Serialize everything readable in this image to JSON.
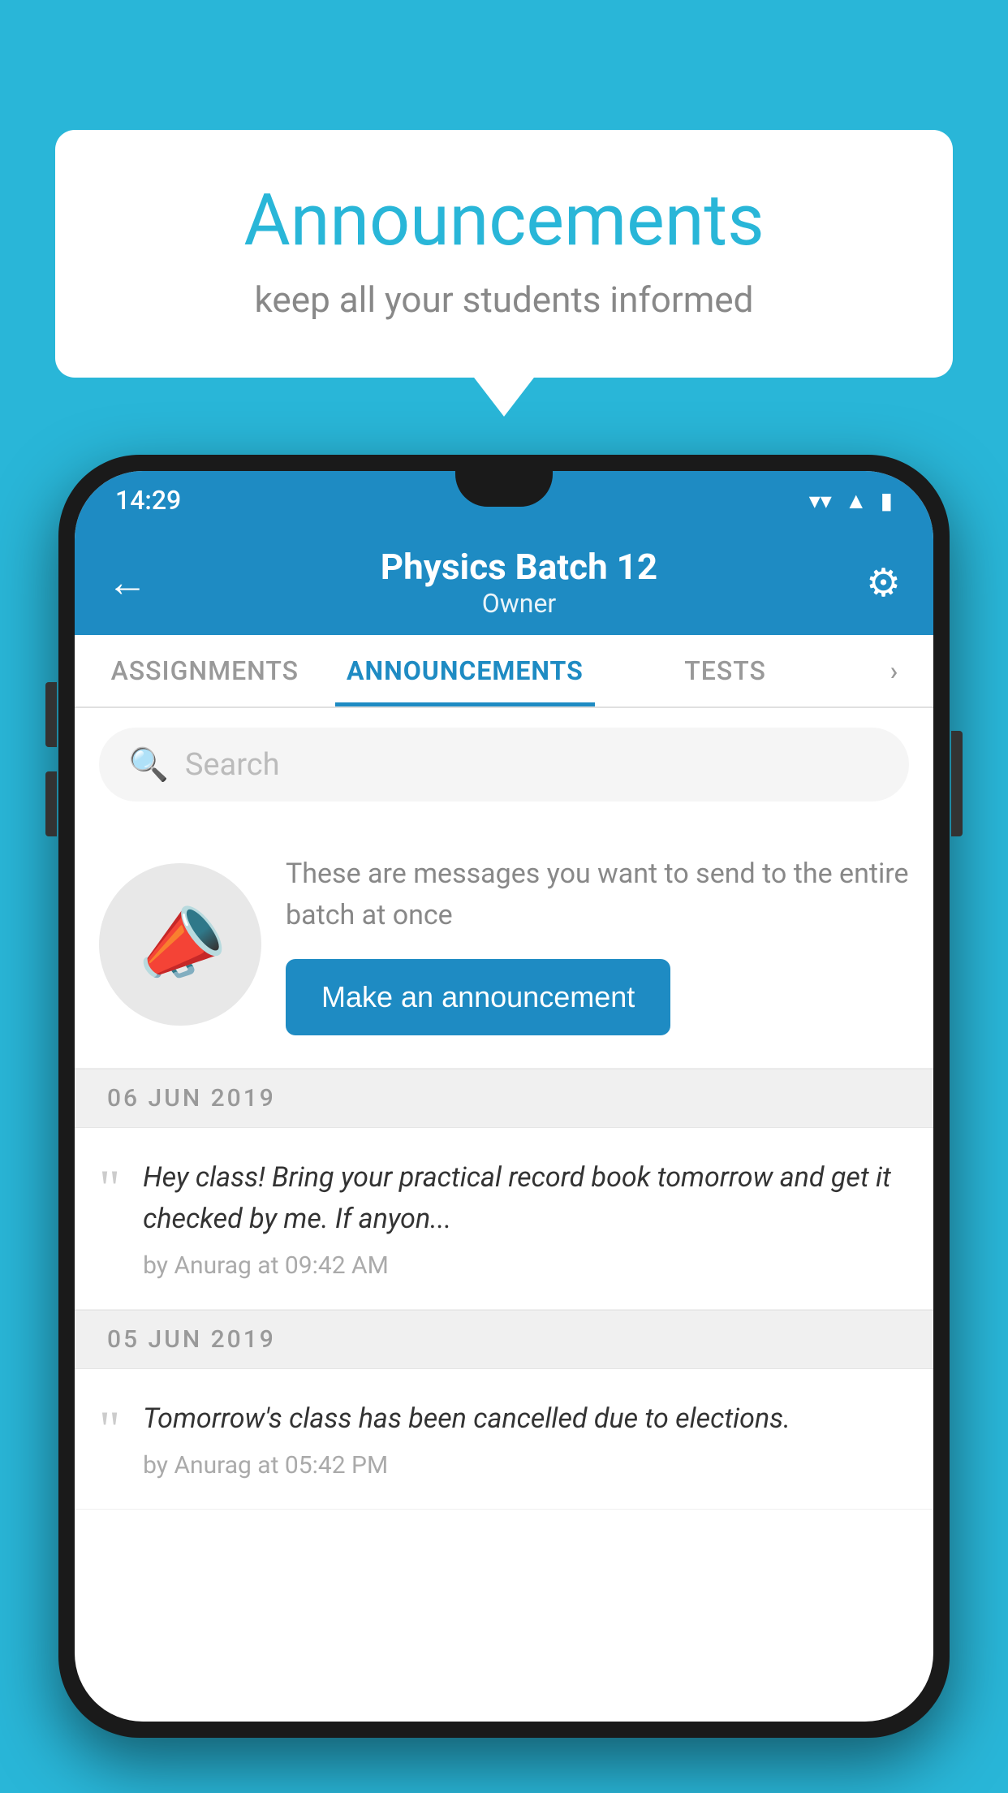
{
  "bubble": {
    "title": "Announcements",
    "subtitle": "keep all your students informed"
  },
  "status_bar": {
    "time": "14:29",
    "wifi": "▼",
    "signal": "▲",
    "battery": "▮"
  },
  "header": {
    "title": "Physics Batch 12",
    "subtitle": "Owner",
    "back_label": "←",
    "settings_label": "⚙"
  },
  "tabs": [
    {
      "label": "ASSIGNMENTS",
      "active": false
    },
    {
      "label": "ANNOUNCEMENTS",
      "active": true
    },
    {
      "label": "TESTS",
      "active": false
    },
    {
      "label": "›",
      "active": false
    }
  ],
  "search": {
    "placeholder": "Search"
  },
  "promo": {
    "description": "These are messages you want to send to the entire batch at once",
    "button_label": "Make an announcement"
  },
  "announcements": [
    {
      "date": "06  JUN  2019",
      "text": "Hey class! Bring your practical record book tomorrow and get it checked by me. If anyon...",
      "meta": "by Anurag at 09:42 AM"
    },
    {
      "date": "05  JUN  2019",
      "text": "Tomorrow's class has been cancelled due to elections.",
      "meta": "by Anurag at 05:42 PM"
    }
  ]
}
